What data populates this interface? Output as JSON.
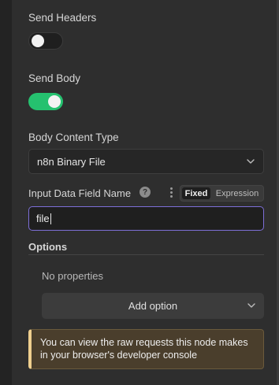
{
  "send_headers": {
    "label": "Send Headers",
    "enabled": false
  },
  "send_body": {
    "label": "Send Body",
    "enabled": true
  },
  "body_content_type": {
    "label": "Body Content Type",
    "value": "n8n Binary File"
  },
  "input_field": {
    "label": "Input Data Field Name",
    "mode_fixed": "Fixed",
    "mode_expression": "Expression",
    "active_mode": "Fixed",
    "value": "file"
  },
  "options": {
    "title": "Options",
    "empty_text": "No properties",
    "add_label": "Add option"
  },
  "notice": {
    "text": "You can view the raw requests this node makes in your browser's developer console"
  },
  "colors": {
    "toggle_on": "#25c16f",
    "focus_border": "#7d6fd8",
    "notice_accent": "#efcf8e"
  }
}
